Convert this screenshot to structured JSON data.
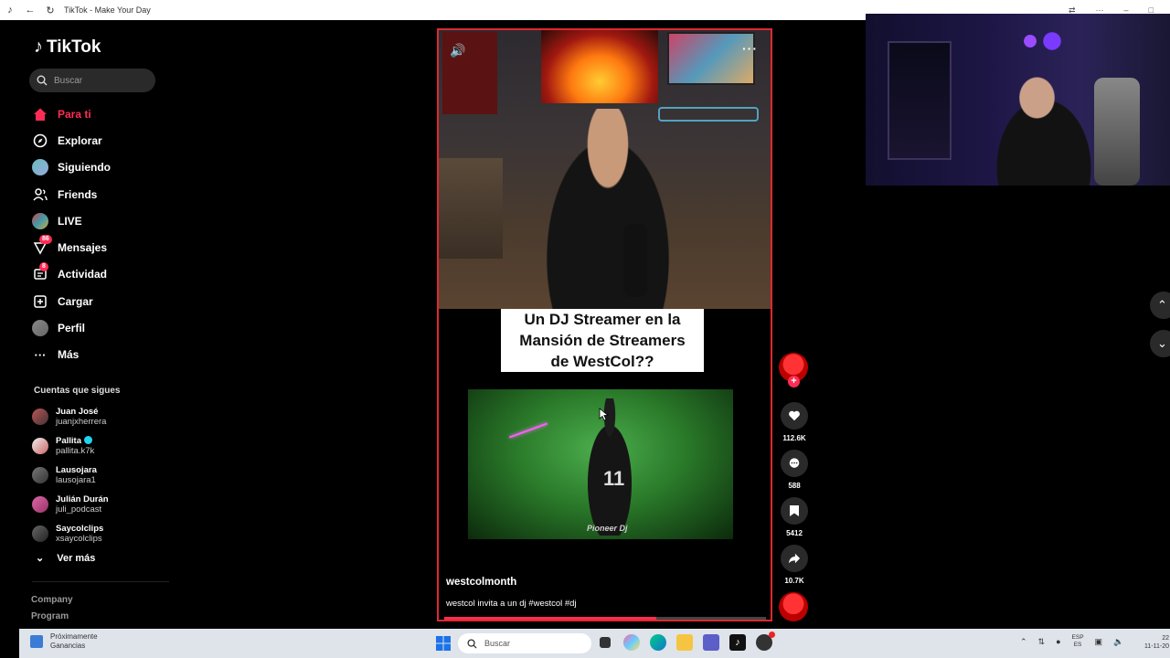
{
  "browser": {
    "title": "TikTok - Make Your Day"
  },
  "sidebar": {
    "logo": "TikTok",
    "search_placeholder": "Buscar",
    "nav": [
      {
        "label": "Para ti",
        "icon": "home-icon"
      },
      {
        "label": "Explorar",
        "icon": "compass-icon"
      },
      {
        "label": "Siguiendo",
        "icon": "following-avatar-icon"
      },
      {
        "label": "Friends",
        "icon": "friends-icon"
      },
      {
        "label": "LIVE",
        "icon": "live-icon"
      },
      {
        "label": "Mensajes",
        "icon": "message-icon",
        "badge": "86"
      },
      {
        "label": "Actividad",
        "icon": "activity-icon",
        "badge": "8"
      },
      {
        "label": "Cargar",
        "icon": "upload-icon"
      },
      {
        "label": "Perfil",
        "icon": "profile-avatar-icon"
      },
      {
        "label": "Más",
        "icon": "more-icon"
      }
    ],
    "following_title": "Cuentas que sigues",
    "following": [
      {
        "name": "Juan José",
        "handle": "juanjxherrera"
      },
      {
        "name": "Pallita",
        "handle": "pallita.k7k",
        "verified": true
      },
      {
        "name": "Lausojara",
        "handle": "lausojara1"
      },
      {
        "name": "Julián Durán",
        "handle": "juli_podcast"
      },
      {
        "name": "Saycolclips",
        "handle": "xsaycolclips"
      }
    ],
    "see_more": "Ver más",
    "footer_links": [
      "Company",
      "Program"
    ]
  },
  "video": {
    "caption_lines": [
      "Un DJ Streamer en la",
      "Mansión de Streamers",
      "de WestCol??"
    ],
    "inset_number": "11",
    "inset_brand": "Pioneer Dj",
    "username": "westcolmonth",
    "description": "westcol invita a un dj #westcol #dj",
    "progress": 0.66
  },
  "actions": {
    "likes": "112.6K",
    "comments": "588",
    "saves": "5412",
    "shares": "10.7K"
  },
  "taskbar": {
    "weather_line1": "Próximamente",
    "weather_line2": "Ganancias",
    "search_placeholder": "Buscar",
    "lang_line1": "ESP",
    "lang_line2": "ES",
    "time": "22",
    "date": "11-11-20"
  },
  "colors": {
    "accent": "#fe2c55",
    "video_border": "#e0282f"
  }
}
